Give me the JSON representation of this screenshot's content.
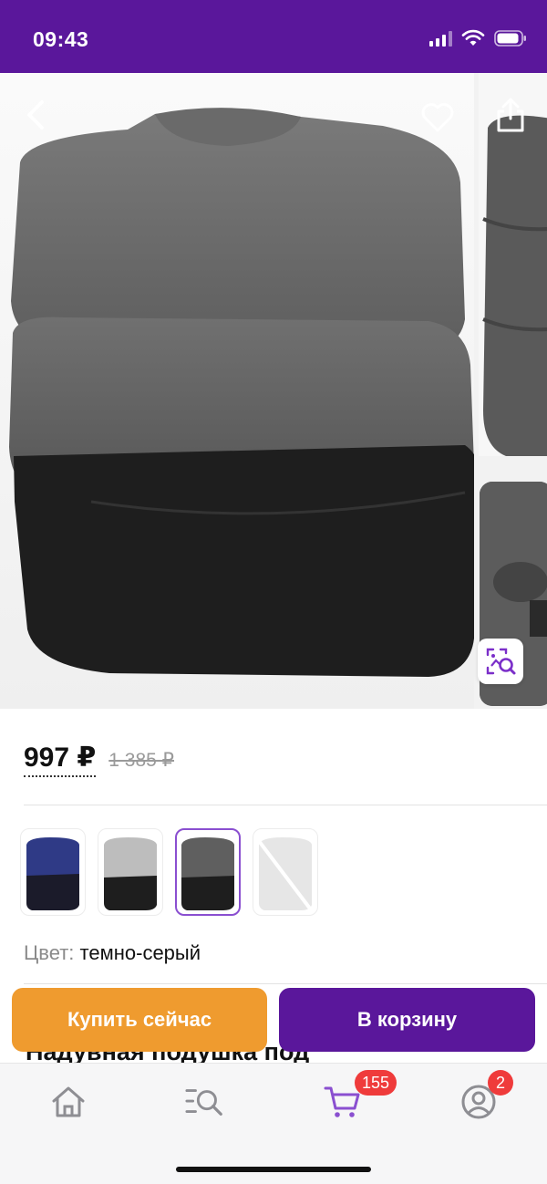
{
  "status_bar": {
    "time": "09:43",
    "bg_color": "#5a179b"
  },
  "gallery": {
    "back_icon": "chevron-left-icon",
    "favorite_icon": "heart-outline-icon",
    "share_icon": "share-icon",
    "visual_search_icon": "image-search-icon"
  },
  "product": {
    "price": "997 ₽",
    "old_price": "1 385 ₽",
    "color_label": "Цвет:",
    "color_value": "темно-серый",
    "title_partial": "Надувная подушка под",
    "swatches": [
      {
        "color": "#2f3a86",
        "selected": false
      },
      {
        "color": "#bdbdbd",
        "selected": false
      },
      {
        "color": "#5f5f5f",
        "selected": true
      },
      {
        "color": "#e6e6e6",
        "selected": false
      }
    ]
  },
  "actions": {
    "buy_now": "Купить сейчас",
    "add_to_cart": "В корзину",
    "buy_color": "#ef9b2f",
    "cart_color": "#5a179b"
  },
  "tab_bar": {
    "items": [
      {
        "icon": "home-icon"
      },
      {
        "icon": "catalog-search-icon"
      },
      {
        "icon": "cart-icon",
        "badge": "155"
      },
      {
        "icon": "profile-icon",
        "badge": "2"
      }
    ],
    "accent_color": "#8a4fd0"
  }
}
